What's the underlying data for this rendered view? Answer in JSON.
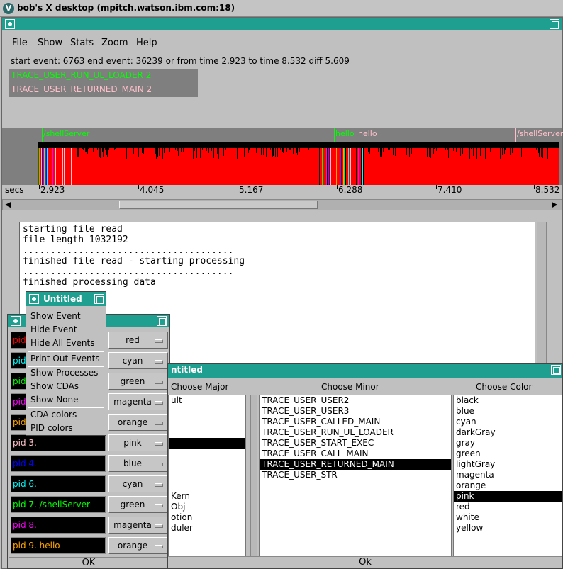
{
  "desktop": {
    "title": "bob's X desktop (mpitch.watson.ibm.com:18)",
    "logo": "V"
  },
  "menu": [
    "File",
    "Show",
    "Stats",
    "Zoom",
    "Help"
  ],
  "range": {
    "text": "start event: 6763  end event: 36239  or from time 2.923 to time 8.532  diff 5.609"
  },
  "events": [
    {
      "label": "TRACE_USER_RUN_UL_LOADER 2",
      "color": "#00ff00"
    },
    {
      "label": "TRACE_USER_RETURNED_MAIN 2",
      "color": "#ffc0cb"
    }
  ],
  "timeline": {
    "marks": [
      {
        "label": "/shellServer",
        "color": "#00ff00"
      },
      {
        "label": "hello",
        "color": "#00ff00"
      },
      {
        "label": "hello",
        "color": "#ffc0cb"
      },
      {
        "label": "/shellServer",
        "color": "#ffc0cb"
      }
    ],
    "unit": "secs",
    "ticks": [
      "2.923",
      "4.045",
      "5.167",
      "6.288",
      "7.410",
      "8.532"
    ]
  },
  "console": {
    "lines": [
      "starting file read",
      "file length 1032192",
      "......................................",
      "finished file read - starting processing",
      "......................................",
      "finished processing data"
    ]
  },
  "popup": {
    "title": "Untitled",
    "options": [
      "Show Event",
      "Hide Event",
      "Hide All Events",
      "Print Out Events",
      "Show Processes",
      "Show CDAs",
      "Show None",
      "CDA colors",
      "PID colors"
    ]
  },
  "pid": {
    "rows": [
      {
        "label": "pid",
        "color": "red",
        "textcolor": "#ff0000"
      },
      {
        "label": "pid",
        "color": "cyan",
        "textcolor": "#00ffff"
      },
      {
        "label": "pid",
        "color": "green",
        "textcolor": "#00ff00"
      },
      {
        "label": "pid",
        "color": "magenta",
        "textcolor": "#ff00ff"
      },
      {
        "label": "pid",
        "color": "orange",
        "textcolor": "#ffa500"
      },
      {
        "label": "pid 3.",
        "color": "pink",
        "textcolor": "#ffc0cb"
      },
      {
        "label": "pid 4.",
        "color": "blue",
        "textcolor": "#0000ff"
      },
      {
        "label": "pid 6.",
        "color": "cyan",
        "textcolor": "#00ffff"
      },
      {
        "label": "pid 7. /shellServer",
        "color": "green",
        "textcolor": "#00ff00"
      },
      {
        "label": "pid 8.",
        "color": "magenta",
        "textcolor": "#ff00ff"
      },
      {
        "label": "pid 9. hello",
        "color": "orange",
        "textcolor": "#ffa500"
      }
    ],
    "ok": "OK"
  },
  "choose": {
    "title": "ntitled",
    "headers": {
      "major": "Choose Major",
      "minor": "Choose Minor",
      "color": "Choose Color"
    },
    "major": [
      "ult",
      "",
      "",
      "",
      "",
      "",
      "",
      "",
      "",
      "Kern",
      "Obj",
      "otion",
      "duler"
    ],
    "major_selected": 4,
    "minor": [
      "TRACE_USER_USER2",
      "TRACE_USER_USER3",
      "TRACE_USER_CALLED_MAIN",
      "TRACE_USER_RUN_UL_LOADER",
      "TRACE_USER_START_EXEC",
      "TRACE_USER_CALL_MAIN",
      "TRACE_USER_RETURNED_MAIN",
      "TRACE_USER_STR"
    ],
    "minor_selected": 6,
    "colors": [
      "black",
      "blue",
      "cyan",
      "darkGray",
      "gray",
      "green",
      "lightGray",
      "magenta",
      "orange",
      "pink",
      "red",
      "white",
      "yellow"
    ],
    "color_selected": 9,
    "ok": "Ok"
  }
}
